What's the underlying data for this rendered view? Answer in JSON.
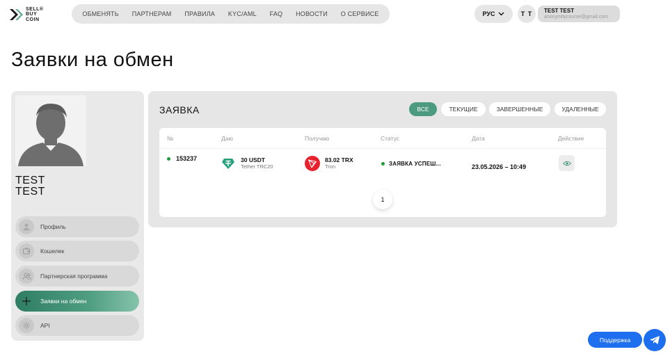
{
  "brand": {
    "logo_text": "SELL® BUY COIN"
  },
  "nav": {
    "items": [
      "ОБМЕНЯТЬ",
      "ПАРТНЕРАМ",
      "ПРАВИЛА",
      "KYC/AML",
      "FAQ",
      "НОВОСТИ",
      "О СЕРВИСЕ"
    ]
  },
  "header": {
    "language": "РУС",
    "initials": "T T",
    "user_name": "TEST TEST",
    "user_email": "anonymitycourse@gmail.com"
  },
  "page_title": "Заявки на обмен",
  "sidebar": {
    "profile_name_line1": "TEST",
    "profile_name_line2": "TEST",
    "items": [
      {
        "label": "Профиль",
        "icon": "user-icon"
      },
      {
        "label": "Кошелек",
        "icon": "wallet-icon"
      },
      {
        "label": "Партнерская программа",
        "icon": "partners-icon"
      },
      {
        "label": "Заявки на обмен",
        "icon": "exchange-icon",
        "active": true
      },
      {
        "label": "API",
        "icon": "gear-icon"
      }
    ]
  },
  "panel": {
    "title": "ЗАЯВКА",
    "filters": [
      "ВСЕ",
      "ТЕКУЩИЕ",
      "ЗАВЕРШЕННЫЕ",
      "УДАЛЕННЫЕ"
    ],
    "active_filter": "ВСЕ",
    "columns": [
      "№",
      "Даю",
      "Получаю",
      "Статус",
      "Дата",
      "Действие"
    ],
    "rows": [
      {
        "id": "153237",
        "give_amount": "30 USDT",
        "give_network": "Tether TRC20",
        "get_amount": "83.02 TRX",
        "get_network": "Tron",
        "status": "ЗАЯВКА УСПЕШ...",
        "date": "23.05.2026 – 10:49"
      }
    ],
    "page": "1"
  },
  "support": {
    "label": "Поддержка"
  },
  "colors": {
    "accent": "#4c9a80",
    "status_ok": "#1f9d3a",
    "tether": "#26a17b",
    "tron": "#e8222d",
    "support": "#1e6ef0"
  }
}
